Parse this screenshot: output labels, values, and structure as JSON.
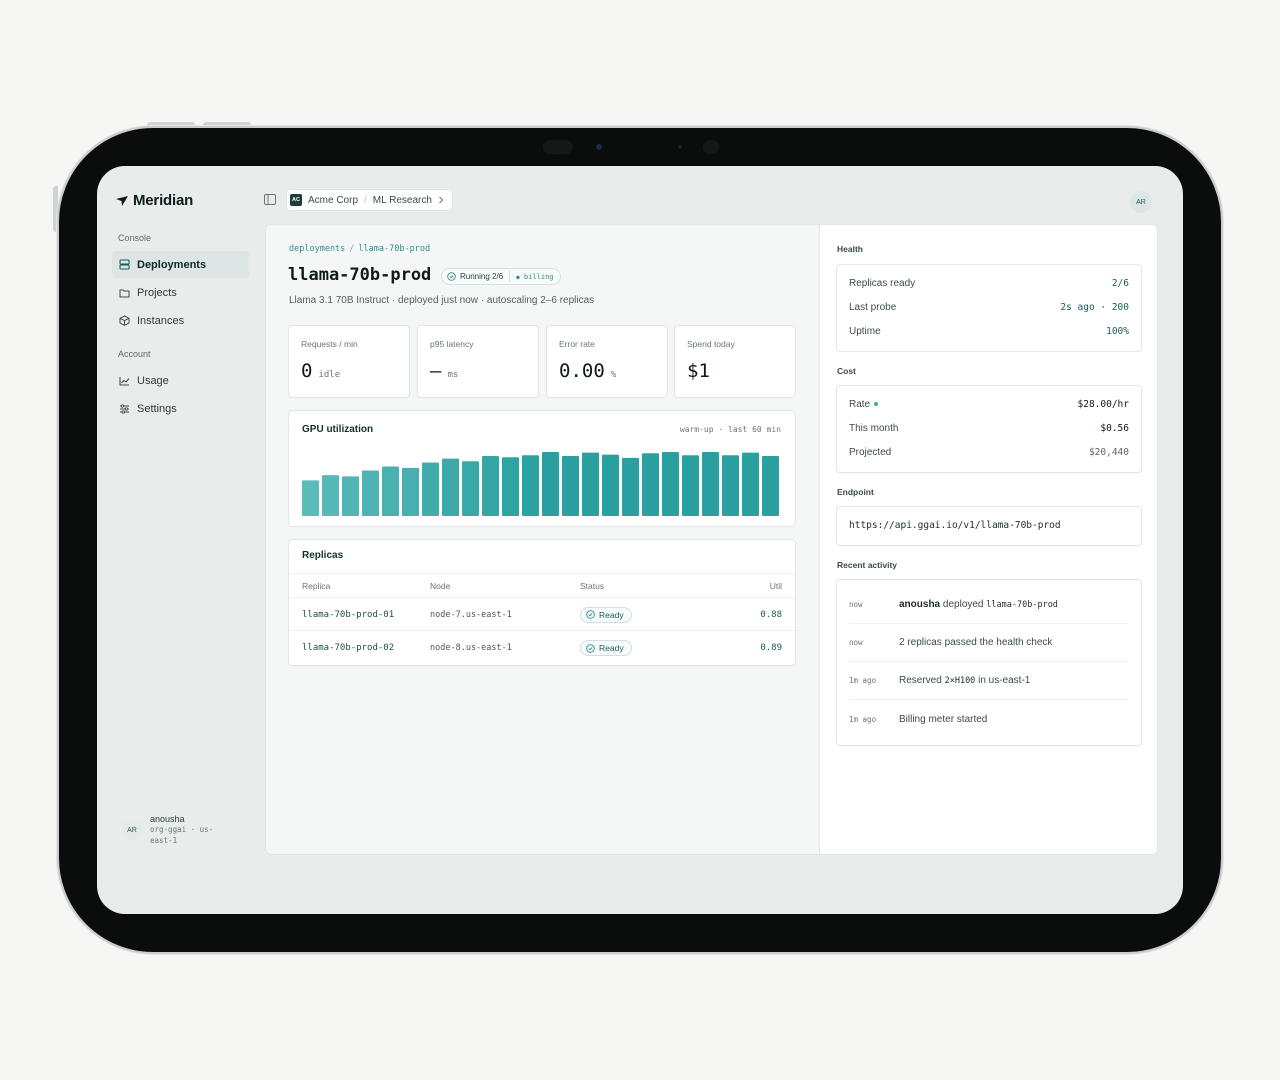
{
  "brand": {
    "name": "Meridian"
  },
  "sidebar": {
    "section_console": "Console",
    "section_account": "Account",
    "items": [
      {
        "label": "Deployments"
      },
      {
        "label": "Projects"
      },
      {
        "label": "Instances"
      },
      {
        "label": "Usage"
      },
      {
        "label": "Settings"
      }
    ],
    "user": {
      "initials": "AR",
      "name": "anousha",
      "org": "org-ggai · us-east-1"
    }
  },
  "topbar": {
    "org_badge": "AC",
    "org": "Acme Corp",
    "project": "ML Research",
    "avatar": "AR"
  },
  "deployment": {
    "crumb_root": "deployments",
    "crumb_current": "llama-70b-prod",
    "title": "llama-70b-prod",
    "status": "Running 2/6",
    "billing": "billing",
    "subtitle": "Llama 3.1 70B Instruct · deployed just now · autoscaling 2–6 replicas"
  },
  "stats": [
    {
      "label": "Requests / min",
      "value": "0",
      "unit": "idle"
    },
    {
      "label": "p95 latency",
      "value": "—",
      "unit": "ms"
    },
    {
      "label": "Error rate",
      "value": "0.00",
      "unit": "%"
    },
    {
      "label": "Spend today",
      "value": "$1",
      "unit": ""
    }
  ],
  "gpu": {
    "title": "GPU utilization",
    "meta": "warm-up · last 60 min"
  },
  "chart_data": {
    "type": "bar",
    "title": "GPU utilization",
    "ylim": [
      0,
      1
    ],
    "values": [
      0.54,
      0.62,
      0.6,
      0.69,
      0.75,
      0.73,
      0.81,
      0.87,
      0.83,
      0.91,
      0.89,
      0.92,
      0.97,
      0.91,
      0.96,
      0.93,
      0.88,
      0.95,
      0.97,
      0.92,
      0.97,
      0.92,
      0.96,
      0.91
    ]
  },
  "replicas": {
    "title": "Replicas",
    "columns": [
      "Replica",
      "Node",
      "Status",
      "Util"
    ],
    "rows": [
      {
        "replica": "llama-70b-prod-01",
        "node": "node-7.us-east-1",
        "status": "Ready",
        "util": "0.88"
      },
      {
        "replica": "llama-70b-prod-02",
        "node": "node-8.us-east-1",
        "status": "Ready",
        "util": "0.89"
      }
    ]
  },
  "health": {
    "label": "Health",
    "rows": [
      {
        "k": "Replicas ready",
        "v": "2/6"
      },
      {
        "k": "Last probe",
        "v": "2s ago · 200"
      },
      {
        "k": "Uptime",
        "v": "100%"
      }
    ]
  },
  "cost": {
    "label": "Cost",
    "rows": [
      {
        "k": "Rate",
        "v": "$28.00/hr"
      },
      {
        "k": "This month",
        "v": "$0.56"
      },
      {
        "k": "Projected",
        "v": "$20,440"
      }
    ]
  },
  "endpoint": {
    "label": "Endpoint",
    "url": "https://api.ggai.io/v1/llama-70b-prod"
  },
  "activity": {
    "label": "Recent activity",
    "items": [
      {
        "time": "now",
        "actor": "anousha",
        "text": "deployed",
        "code": "llama-70b-prod"
      },
      {
        "time": "now",
        "text": "2 replicas passed the health check"
      },
      {
        "time": "1m ago",
        "text": "Reserved",
        "code": "2×H100",
        "suffix": "in us-east-1"
      },
      {
        "time": "1m ago",
        "text": "Billing meter started"
      }
    ]
  },
  "colors": {
    "accent": "#2aa3a0",
    "brand_dark": "#0f1a1a"
  }
}
